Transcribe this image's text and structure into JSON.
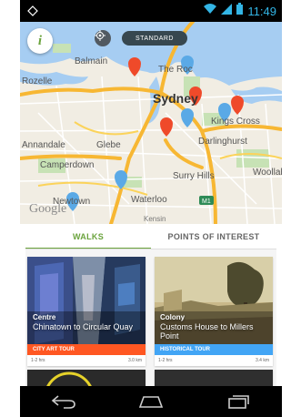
{
  "status_bar": {
    "time": "11:49"
  },
  "map": {
    "standard_label": "STANDARD",
    "google_label": "Google",
    "labels": [
      {
        "id": "balmain",
        "text": "Balmain"
      },
      {
        "id": "the-rocks",
        "text": "The Roc"
      },
      {
        "id": "rozelle",
        "text": "Rozelle"
      },
      {
        "id": "sydney",
        "text": "Sydney"
      },
      {
        "id": "kings-cross",
        "text": "Kings Cross"
      },
      {
        "id": "darlinghurst",
        "text": "Darlinghurst"
      },
      {
        "id": "annandale",
        "text": "Annandale"
      },
      {
        "id": "glebe",
        "text": "Glebe"
      },
      {
        "id": "camperdown",
        "text": "Camperdown"
      },
      {
        "id": "surry-hills",
        "text": "Surry Hills"
      },
      {
        "id": "woollahra",
        "text": "Woollah"
      },
      {
        "id": "newtown",
        "text": "Newtown"
      },
      {
        "id": "waterloo",
        "text": "Waterloo"
      },
      {
        "id": "kensington",
        "text": "Kensin"
      }
    ]
  },
  "tabs": {
    "walks": "WALKS",
    "points_of_interest": "POINTS OF INTEREST"
  },
  "cards": [
    {
      "title": "Centre",
      "subtitle": "Chinatown to Circular Quay",
      "tag": "CITY ART TOUR",
      "tag_color": "#ff5722",
      "duration": "1-2 hrs",
      "distance": "3.0 km"
    },
    {
      "title": "Colony",
      "subtitle": "Customs House to Millers Point",
      "tag": "HISTORICAL TOUR",
      "tag_color": "#42a5f5",
      "duration": "1-2 hrs",
      "distance": "3.4 km"
    }
  ],
  "colors": {
    "accent_green": "#6aa33c",
    "marker_red": "#ef4a2a",
    "marker_blue": "#5aa9e6"
  }
}
